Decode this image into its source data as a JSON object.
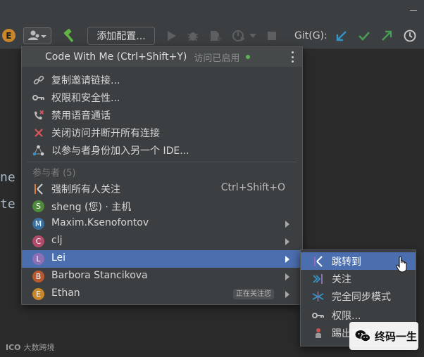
{
  "toolbar": {
    "user_avatar_letter": "E",
    "add_config_label": "添加配置...",
    "git_label": "Git(G):"
  },
  "editor": {
    "code_line_1": "ne",
    "code_line_2": "te"
  },
  "popup": {
    "title": "Code With Me (Ctrl+Shift+Y)",
    "status": "访问已启用",
    "items": [
      {
        "label": "复制邀请链接...",
        "icon": "link-icon"
      },
      {
        "label": "权限和安全性...",
        "icon": "key-icon"
      },
      {
        "label": "禁用语音通话",
        "icon": "phone-off-icon"
      },
      {
        "label": "关闭访问并断开所有连接",
        "icon": "close-icon"
      },
      {
        "label": "以参与者身份加入另一个 IDE...",
        "icon": "join-ide-icon"
      }
    ],
    "participants_header": "参与者 (5)",
    "force_follow": {
      "label": "强制所有人关注",
      "shortcut": "Ctrl+Shift+O"
    },
    "participants": [
      {
        "letter": "S",
        "name": "sheng (您) · 主机",
        "color": "#4e8a3a",
        "has_submenu": false,
        "badge": ""
      },
      {
        "letter": "M",
        "name": "Maxim.Ksenofontov",
        "color": "#3a6f9c",
        "has_submenu": true,
        "badge": ""
      },
      {
        "letter": "C",
        "name": "clj",
        "color": "#b24a6a",
        "has_submenu": true,
        "badge": ""
      },
      {
        "letter": "L",
        "name": "Lei",
        "color": "#8e6fb5",
        "has_submenu": true,
        "badge": "",
        "selected": true
      },
      {
        "letter": "B",
        "name": "Barbora Stancikova",
        "color": "#b8582f",
        "has_submenu": true,
        "badge": ""
      },
      {
        "letter": "E",
        "name": "Ethan",
        "color": "#c9862b",
        "has_submenu": true,
        "badge": "正在关注您"
      }
    ]
  },
  "submenu": {
    "items": [
      {
        "label": "跳转到",
        "icon": "follow-icon",
        "selected": true
      },
      {
        "label": "关注",
        "icon": "follow-icon",
        "selected": false
      },
      {
        "label": "完全同步模式",
        "icon": "sync-icon",
        "selected": false
      },
      {
        "label": "权限...",
        "icon": "key-icon",
        "selected": false
      },
      {
        "label": "踢出项目",
        "icon": "kick-icon",
        "selected": false
      }
    ]
  },
  "watermark": {
    "left_logo": "ICO",
    "left_text": "大数跨境",
    "badge_text": "终码一生"
  },
  "colors": {
    "selection": "#4b6eaf",
    "background": "#2b2b2b",
    "popup_bg": "#3c3f41",
    "git_blue": "#3592c4",
    "git_green": "#499c54"
  }
}
